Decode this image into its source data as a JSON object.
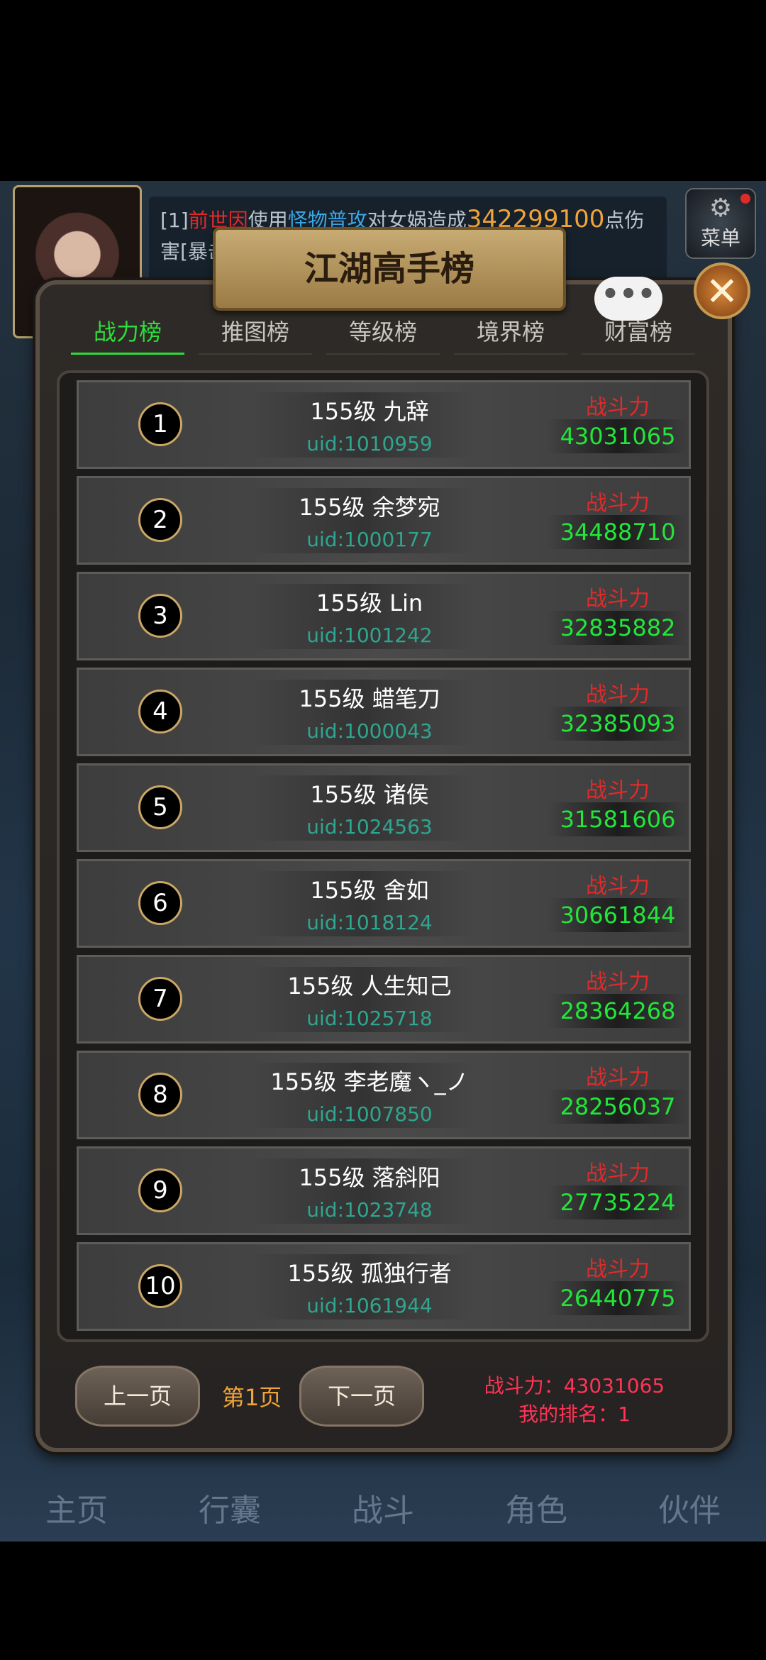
{
  "chat": {
    "prefix": "[1]",
    "player": "前世因",
    "text1": "使用",
    "skill": "怪物普攻",
    "text2": "对女娲造成",
    "damage": "342299100",
    "text3": "点伤",
    "line2": "害[暴击"
  },
  "menu_label": "菜单",
  "panel_title": "江湖高手榜",
  "tabs": [
    "战力榜",
    "推图榜",
    "等级榜",
    "境界榜",
    "财富榜"
  ],
  "active_tab": "战力榜",
  "rows": [
    {
      "rank": "1",
      "name": "155级 九辞",
      "uid": "uid:1010959",
      "power_label": "战斗力",
      "power": "43031065"
    },
    {
      "rank": "2",
      "name": "155级 余梦宛",
      "uid": "uid:1000177",
      "power_label": "战斗力",
      "power": "34488710"
    },
    {
      "rank": "3",
      "name": "155级 Lin",
      "uid": "uid:1001242",
      "power_label": "战斗力",
      "power": "32835882"
    },
    {
      "rank": "4",
      "name": "155级 蜡笔刀",
      "uid": "uid:1000043",
      "power_label": "战斗力",
      "power": "32385093"
    },
    {
      "rank": "5",
      "name": "155级 诸侯",
      "uid": "uid:1024563",
      "power_label": "战斗力",
      "power": "31581606"
    },
    {
      "rank": "6",
      "name": "155级 舍如",
      "uid": "uid:1018124",
      "power_label": "战斗力",
      "power": "30661844"
    },
    {
      "rank": "7",
      "name": "155级 人生知己",
      "uid": "uid:1025718",
      "power_label": "战斗力",
      "power": "28364268"
    },
    {
      "rank": "8",
      "name": "155级 李老魔ヽ_ノ",
      "uid": "uid:1007850",
      "power_label": "战斗力",
      "power": "28256037"
    },
    {
      "rank": "9",
      "name": "155级 落斜阳",
      "uid": "uid:1023748",
      "power_label": "战斗力",
      "power": "27735224"
    },
    {
      "rank": "10",
      "name": "155级 孤独行者",
      "uid": "uid:1061944",
      "power_label": "战斗力",
      "power": "26440775"
    }
  ],
  "pagination": {
    "prev": "上一页",
    "current": "第1页",
    "next": "下一页"
  },
  "my_stats": {
    "power": "战斗力：43031065",
    "rank": "我的排名：1"
  },
  "bottom_nav": [
    "主页",
    "行囊",
    "战斗",
    "角色",
    "伙伴"
  ],
  "colors": {
    "active_tab": "#2edd3a",
    "power_label": "#e22a2a",
    "power_value": "#22e63a",
    "uid": "#2fa58f",
    "page_num": "#f0a33a"
  }
}
